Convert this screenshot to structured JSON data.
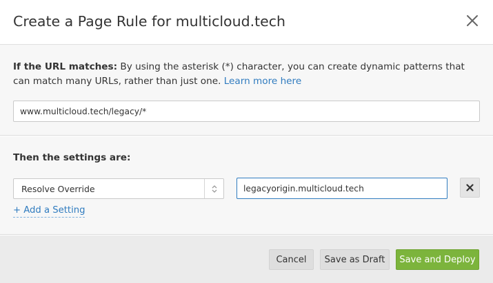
{
  "dialog": {
    "title": "Create a Page Rule for multicloud.tech"
  },
  "url_section": {
    "label": "If the URL matches:",
    "description": " By using the asterisk (*) character, you can create dynamic patterns that can match many URLs, rather than just one. ",
    "learn_more": "Learn more here",
    "url_value": "www.multicloud.tech/legacy/*"
  },
  "settings": {
    "title": "Then the settings are:",
    "setting_select_value": "Resolve Override",
    "setting_value": "legacyorigin.multicloud.tech",
    "add_setting": "+ Add a Setting"
  },
  "footer": {
    "cancel": "Cancel",
    "save_draft": "Save as Draft",
    "save_deploy": "Save and Deploy"
  },
  "colors": {
    "link": "#2f7bbf",
    "primary_button": "#7cb43c"
  },
  "icons": {
    "close": "close-icon",
    "select_arrows": "updown-chevron-icon",
    "remove": "x-icon"
  }
}
